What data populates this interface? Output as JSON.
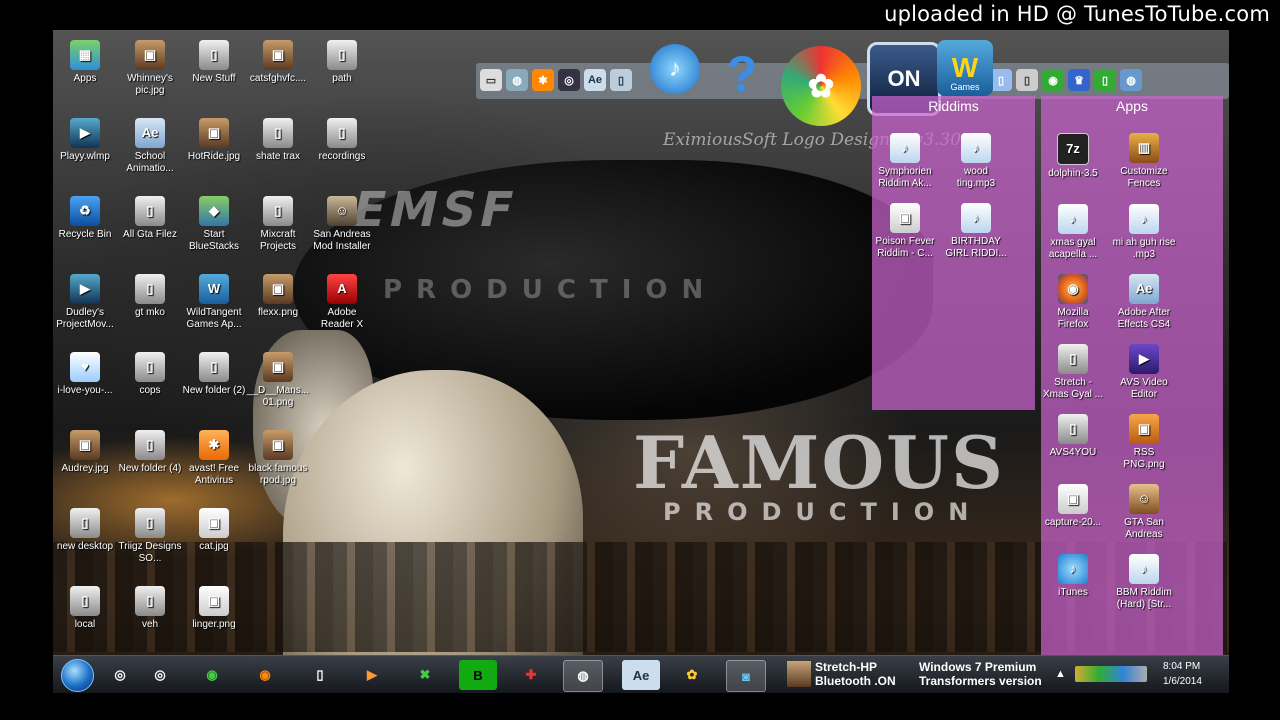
{
  "watermark": "uploaded in HD @ TunesToTube.com",
  "wallpaper": {
    "logo_top": "EMSF",
    "logo_top_sub": "PRODUCTION",
    "logo_main": "FAMOUS",
    "logo_main_sub": "PRODUCTION",
    "eximious_text": "EximiousSoft Logo Designer v3.30"
  },
  "desktop_icons": [
    {
      "label": "Apps",
      "glyph": "▦"
    },
    {
      "label": "Whinney's pic.jpg",
      "glyph": "▣"
    },
    {
      "label": "New Stuff",
      "glyph": "▯"
    },
    {
      "label": "catsfghvfc....",
      "glyph": "▣"
    },
    {
      "label": "path",
      "glyph": "▯"
    },
    {
      "label": "Playy.wlmp",
      "glyph": "▶"
    },
    {
      "label": "School Animatio...",
      "glyph": "Ae"
    },
    {
      "label": "HotRide.jpg",
      "glyph": "▣"
    },
    {
      "label": "shate trax",
      "glyph": "▯"
    },
    {
      "label": "recordings",
      "glyph": "▯"
    },
    {
      "label": "Recycle Bin",
      "glyph": "♻"
    },
    {
      "label": "All Gta Filez",
      "glyph": "▯"
    },
    {
      "label": "Start BlueStacks",
      "glyph": "◆"
    },
    {
      "label": "Mixcraft Projects",
      "glyph": "▯"
    },
    {
      "label": "San Andreas Mod Installer",
      "glyph": "☺"
    },
    {
      "label": "Dudley's ProjectMov...",
      "glyph": "▶"
    },
    {
      "label": "gt mko",
      "glyph": "▯"
    },
    {
      "label": "WildTangent Games Ap...",
      "glyph": "W"
    },
    {
      "label": "flexx.png",
      "glyph": "▣"
    },
    {
      "label": "Adobe Reader X",
      "glyph": "A"
    },
    {
      "label": "i-love-you-...",
      "glyph": "♥"
    },
    {
      "label": "cops",
      "glyph": "▯"
    },
    {
      "label": "New folder (2)",
      "glyph": "▯"
    },
    {
      "label": "__D__Mans... 01.png",
      "glyph": "▣"
    },
    {
      "label": "Audrey.jpg",
      "glyph": "▣"
    },
    {
      "label": "New folder (4)",
      "glyph": "▯"
    },
    {
      "label": "avast! Free Antivirus",
      "glyph": "✱"
    },
    {
      "label": "black famous rpod.jpg",
      "glyph": "▣"
    },
    {
      "label": "new desktop",
      "glyph": "▯"
    },
    {
      "label": "Triigz Designs SO...",
      "glyph": "▯"
    },
    {
      "label": "cat.jpg",
      "glyph": "▣"
    },
    {
      "label": "local",
      "glyph": "▯"
    },
    {
      "label": "veh",
      "glyph": "▯"
    },
    {
      "label": "linger.png",
      "glyph": "▣"
    }
  ],
  "fences": {
    "riddims": {
      "title": "Riddims",
      "items": [
        {
          "label": "Symphorien Riddim Ak...",
          "glyph": "♪"
        },
        {
          "label": "wood ting.mp3",
          "glyph": "♪"
        },
        {
          "label": "Poison Fever Riddim - C...",
          "glyph": "▣"
        },
        {
          "label": "BIRTHDAY GIRL RIDDI...",
          "glyph": "♪"
        }
      ]
    },
    "apps": {
      "title": "Apps",
      "items": [
        {
          "label": "dolphin-3.5",
          "glyph": "7z"
        },
        {
          "label": "Customize Fences",
          "glyph": "▥"
        },
        {
          "label": "xmas gyal acapella ...",
          "glyph": "♪"
        },
        {
          "label": "mi ah guh rise .mp3",
          "glyph": "♪"
        },
        {
          "label": "Mozilla Firefox",
          "glyph": "◉"
        },
        {
          "label": "Adobe After Effects CS4",
          "glyph": "Ae"
        },
        {
          "label": "Stretch - Xmas Gyal ...",
          "glyph": "▯"
        },
        {
          "label": "AVS Video Editor",
          "glyph": "▶"
        },
        {
          "label": "AVS4YOU",
          "glyph": "▯"
        },
        {
          "label": "RSS PNG.png",
          "glyph": "▣"
        },
        {
          "label": "capture-20...",
          "glyph": "▣"
        },
        {
          "label": "GTA San Andreas",
          "glyph": "☺"
        },
        {
          "label": "iTunes",
          "glyph": "♪"
        },
        {
          "label": "BBM Riddim (Hard) [Str...",
          "glyph": "♪"
        }
      ]
    }
  },
  "top_toolbar": {
    "icons": [
      "▭",
      "◍",
      "✱",
      "◎",
      "Ae",
      "▯",
      "♪",
      "?",
      "✿",
      "ON",
      "W",
      "▯",
      "▯",
      "▯",
      "▯",
      "◉",
      "♛",
      "▯",
      "◍"
    ],
    "games_label": "Games"
  },
  "taskbar": {
    "buttons": [
      "◎",
      "◎",
      "◉",
      "◉",
      "▯",
      "▶",
      "✖",
      "B",
      "✚",
      "◍",
      "Ae",
      "✿",
      "◙"
    ],
    "notification_line1": "Stretch-HP",
    "notification_line2": "Bluetooth .ON",
    "windows_line1": "Windows 7 Premium",
    "windows_line2": "Transformers version",
    "time": "8:04 PM",
    "date": "1/6/2014"
  }
}
